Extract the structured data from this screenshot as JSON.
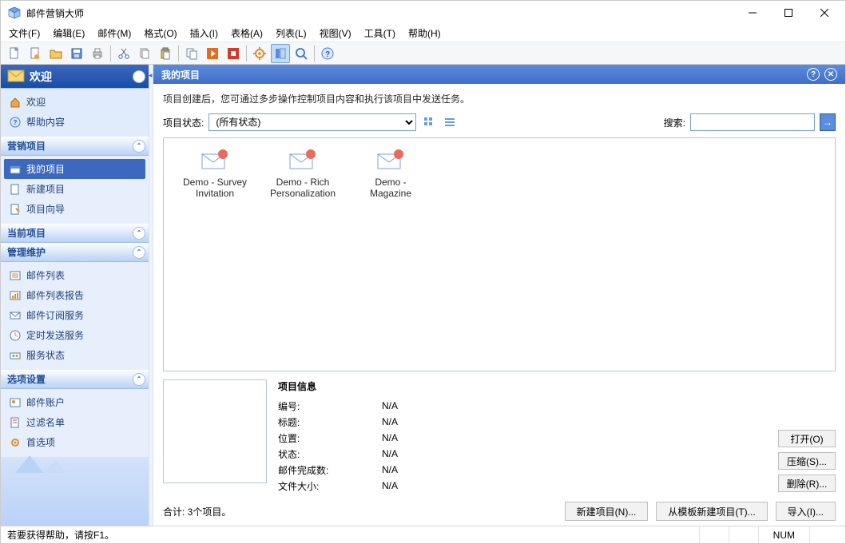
{
  "titlebar": {
    "title": "邮件营销大师"
  },
  "menu": [
    "文件(F)",
    "编辑(E)",
    "邮件(M)",
    "格式(O)",
    "插入(I)",
    "表格(A)",
    "列表(L)",
    "视图(V)",
    "工具(T)",
    "帮助(H)"
  ],
  "sidebar": {
    "welcome": {
      "title": "欢迎",
      "links": [
        "欢迎",
        "帮助内容"
      ]
    },
    "marketing": {
      "title": "营销项目",
      "links": [
        "我的项目",
        "新建项目",
        "项目向导"
      ],
      "selected": 0
    },
    "current": {
      "title": "当前项目"
    },
    "manage": {
      "title": "管理维护",
      "links": [
        "邮件列表",
        "邮件列表报告",
        "邮件订阅服务",
        "定时发送服务",
        "服务状态"
      ]
    },
    "options": {
      "title": "选项设置",
      "links": [
        "邮件账户",
        "过滤名单",
        "首选项"
      ]
    }
  },
  "main": {
    "header": "我的项目",
    "desc": "项目创建后，您可通过多步操作控制项目内容和执行该项目中发送任务。",
    "status_label": "项目状态:",
    "status_value": "(所有状态)",
    "search_label": "搜索:",
    "items": [
      {
        "name": "Demo - Survey Invitation"
      },
      {
        "name": "Demo - Rich Personalization"
      },
      {
        "name": "Demo - Magazine"
      }
    ],
    "info": {
      "title": "项目信息",
      "rows": [
        {
          "k": "编号:",
          "v": "N/A"
        },
        {
          "k": "标题:",
          "v": "N/A"
        },
        {
          "k": "位置:",
          "v": "N/A"
        },
        {
          "k": "状态:",
          "v": "N/A"
        },
        {
          "k": "邮件完成数:",
          "v": "N/A"
        },
        {
          "k": "文件大小:",
          "v": "N/A"
        }
      ]
    },
    "actions": {
      "open": "打开(O)",
      "compress": "压缩(S)...",
      "delete": "删除(R)..."
    },
    "footer": {
      "total": "合计: 3个项目。",
      "new": "新建项目(N)...",
      "tpl": "从模板新建项目(T)...",
      "import": "导入(I)..."
    }
  },
  "status": {
    "help": "若要获得帮助，请按F1。",
    "num": "NUM"
  }
}
